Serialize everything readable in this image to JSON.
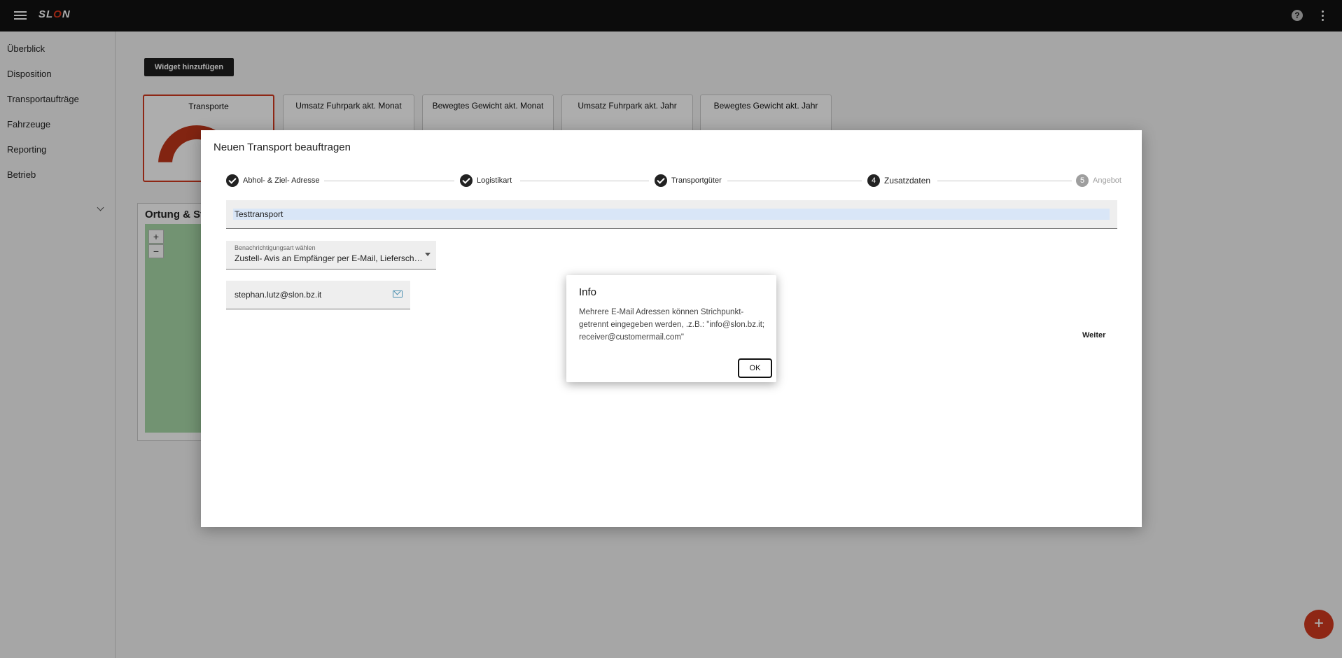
{
  "app": {
    "logo": "SL",
    "logo_o": "O",
    "logo_end": "N"
  },
  "topbar": {
    "help_glyph": "?"
  },
  "sidebar": {
    "items": [
      {
        "label": "Überblick"
      },
      {
        "label": "Disposition"
      },
      {
        "label": "Transportaufträge"
      },
      {
        "label": "Fahrzeuge"
      },
      {
        "label": "Reporting"
      },
      {
        "label": "Betrieb"
      }
    ]
  },
  "dashboard": {
    "add_widget_label": "Widget hinzufügen",
    "cards": [
      {
        "title": "Transporte"
      },
      {
        "title": "Umsatz Fuhrpark akt. Monat"
      },
      {
        "title": "Bewegtes Gewicht akt. Monat"
      },
      {
        "title": "Umsatz Fuhrpark akt. Jahr"
      },
      {
        "title": "Bewegtes Gewicht akt. Jahr"
      }
    ],
    "map_title": "Ortung & St",
    "zoom_in": "+",
    "zoom_out": "−",
    "fab": "+"
  },
  "wizard": {
    "title": "Neuen Transport beauftragen",
    "steps": [
      {
        "label": "Abhol- & Ziel- Adresse",
        "state": "done"
      },
      {
        "label": "Logistikart",
        "state": "done"
      },
      {
        "label": "Transportgüter",
        "state": "done"
      },
      {
        "label": "Zusatzdaten",
        "number": "4",
        "state": "current"
      },
      {
        "label": "Angebot",
        "number": "5",
        "state": "pending"
      }
    ],
    "title_value": "Testtransport",
    "notify_label": "Benachrichtigungsart wählen",
    "notify_value": "Zustell- Avis an Empfänger per E-Mail, Lieferschein",
    "email_value": "stephan.lutz@slon.bz.it",
    "next_label": "Weiter"
  },
  "info_dialog": {
    "title": "Info",
    "text": "Mehrere E-Mail Adressen können Strichpunkt-getrennt eingegeben werden, .z.B.: \"info@slon.bz.it; receiver@customermail.com\"",
    "ok_label": "OK"
  },
  "colors": {
    "accent": "#d23a20",
    "topbar": "#121212",
    "gauge_secondary": "#2a2a9a"
  }
}
